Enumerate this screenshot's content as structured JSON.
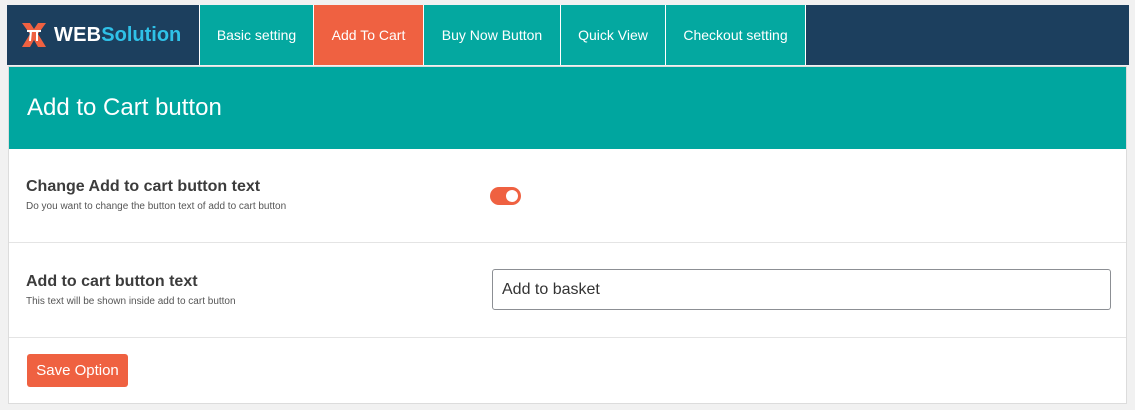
{
  "brand": {
    "web": "WEB",
    "solution": "Solution"
  },
  "tabs": [
    {
      "label": "Basic setting",
      "active": false
    },
    {
      "label": "Add To Cart",
      "active": true
    },
    {
      "label": "Buy Now Button",
      "active": false
    },
    {
      "label": "Quick View",
      "active": false
    },
    {
      "label": "Checkout setting",
      "active": false
    }
  ],
  "panel": {
    "title": "Add to Cart button",
    "change_text": {
      "title": "Change Add to cart button text",
      "description": "Do you want to change the button text of add to cart button",
      "enabled": true
    },
    "button_text": {
      "title": "Add to cart button text",
      "description": "This text will be shown inside add to cart button",
      "value": "Add to basket"
    },
    "save_label": "Save Option"
  },
  "colors": {
    "navbar": "#1c3f5e",
    "teal": "#00a69f",
    "accent": "#ef6141",
    "brand_solution": "#2fc1e8"
  }
}
